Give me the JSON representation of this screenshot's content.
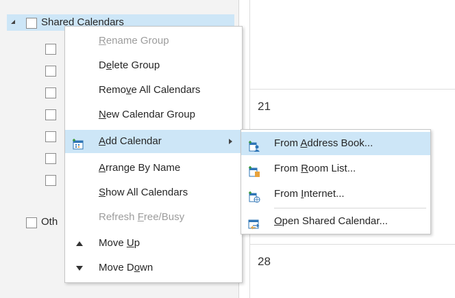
{
  "nav": {
    "group_label": "Shared Calendars",
    "other_label": "Oth"
  },
  "calendar": {
    "day_21": "21",
    "day_28": "28"
  },
  "context_menu": {
    "items": [
      {
        "pre": "",
        "u": "R",
        "post": "ename Group",
        "enabled": false
      },
      {
        "pre": "D",
        "u": "e",
        "post": "lete Group",
        "enabled": true
      },
      {
        "pre": "Remo",
        "u": "v",
        "post": "e All Calendars",
        "enabled": true
      },
      {
        "pre": "",
        "u": "N",
        "post": "ew Calendar Group",
        "enabled": true
      },
      {
        "pre": "",
        "u": "A",
        "post": "dd Calendar",
        "enabled": true,
        "icon": "add-calendar-icon",
        "submenu": true
      },
      {
        "pre": "",
        "u": "A",
        "post": "rrange By Name",
        "enabled": true
      },
      {
        "pre": "",
        "u": "S",
        "post": "how All Calendars",
        "enabled": true
      },
      {
        "pre": "Refresh ",
        "u": "F",
        "post": "ree/Busy",
        "enabled": false
      },
      {
        "pre": "Move ",
        "u": "U",
        "post": "p",
        "enabled": true,
        "icon": "move-up-icon"
      },
      {
        "pre": "Move D",
        "u": "o",
        "post": "wn",
        "enabled": true,
        "icon": "move-down-icon"
      }
    ]
  },
  "submenu": {
    "items": [
      {
        "pre": "From ",
        "u": "A",
        "post": "ddress Book...",
        "icon": "address-book-icon"
      },
      {
        "pre": "From ",
        "u": "R",
        "post": "oom List...",
        "icon": "room-list-icon"
      },
      {
        "pre": "From ",
        "u": "I",
        "post": "nternet...",
        "icon": "internet-calendar-icon"
      },
      {
        "pre": "",
        "u": "O",
        "post": "pen Shared Calendar...",
        "icon": "open-shared-calendar-icon"
      }
    ]
  },
  "colors": {
    "highlight": "#cde6f7",
    "disabled_text": "#9c9c9c",
    "pane_bg": "#f3f3f3",
    "icon_blue": "#2e75b6",
    "icon_orange": "#e8a33d"
  }
}
